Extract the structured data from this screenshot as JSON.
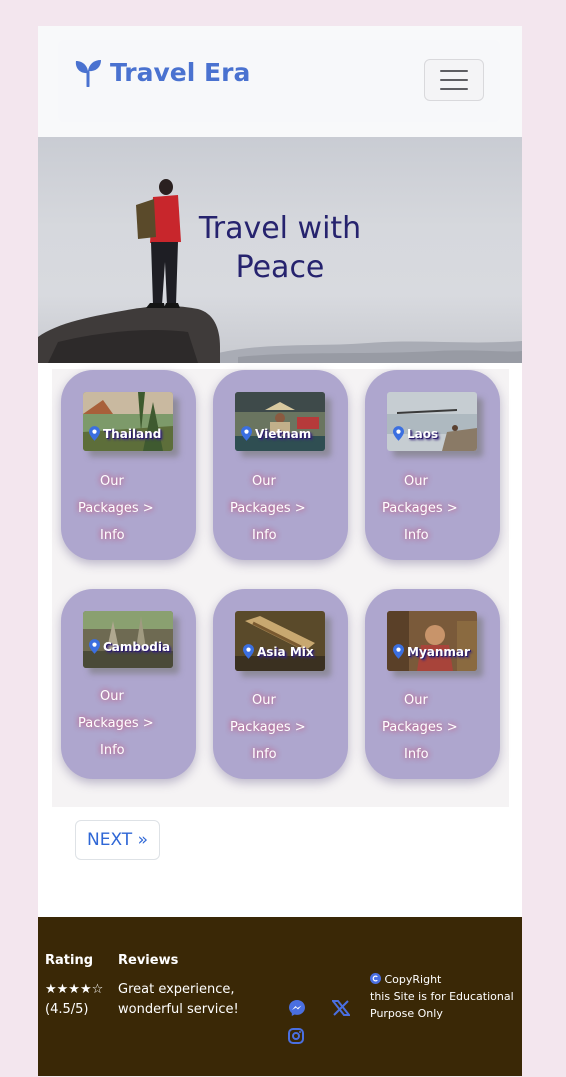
{
  "brand": {
    "name": "Travel Era",
    "icon": "sprout-icon",
    "color": "#4a72d0"
  },
  "nav": {
    "toggle_icon": "hamburger-icon"
  },
  "hero": {
    "title": "Travel with Peace",
    "title_color": "#26236e"
  },
  "cards": [
    {
      "destination": "Thailand",
      "link_line1": "Our",
      "link_line2": "Packages >",
      "link_line3": "Info"
    },
    {
      "destination": "Vietnam",
      "link_line1": "Our",
      "link_line2": "Packages >",
      "link_line3": "Info"
    },
    {
      "destination": "Laos",
      "link_line1": "Our",
      "link_line2": "Packages >",
      "link_line3": "Info"
    },
    {
      "destination": "Cambodia",
      "link_line1": "Our",
      "link_line2": "Packages >",
      "link_line3": "Info"
    },
    {
      "destination": "Asia Mix",
      "link_line1": "Our",
      "link_line2": "Packages >",
      "link_line3": "Info"
    },
    {
      "destination": "Myanmar",
      "link_line1": "Our",
      "link_line2": "Packages >",
      "link_line3": "Info"
    }
  ],
  "pagination": {
    "next_label": "NEXT »"
  },
  "footer": {
    "rating_heading": "Rating",
    "rating_stars": "★★★★☆",
    "rating_value": "(4.5/5)",
    "reviews_heading": "Reviews",
    "review_text": "Great experience, wonderful service!",
    "social_icons": [
      "messenger-icon",
      "x-icon",
      "instagram-icon"
    ],
    "copyright_line1": "CopyRight",
    "copyright_line2": "this Site is for Educational Purpose Only",
    "background": "#3a2806"
  },
  "colors": {
    "card": "#aea6ce",
    "accent": "#2f67d6",
    "page_bg": "#f3e6ee"
  }
}
